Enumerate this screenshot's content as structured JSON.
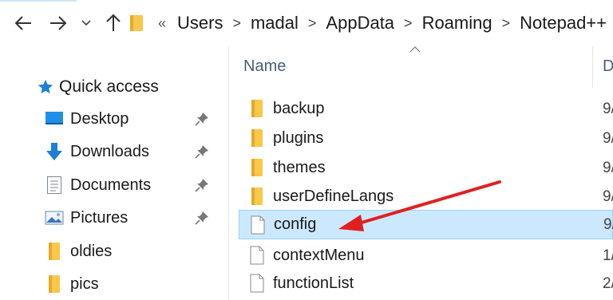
{
  "nav": {
    "back": "back",
    "forward": "forward",
    "recent": "recent-locations",
    "up": "up"
  },
  "breadcrumb": {
    "overflow": "«",
    "items": [
      "Users",
      "madal",
      "AppData",
      "Roaming",
      "Notepad++"
    ],
    "separator": ">"
  },
  "sidebar": {
    "quick_access": "Quick access",
    "items": [
      {
        "label": "Desktop",
        "icon": "desktop-icon",
        "pinned": true
      },
      {
        "label": "Downloads",
        "icon": "download-icon",
        "pinned": true
      },
      {
        "label": "Documents",
        "icon": "documents-icon",
        "pinned": true
      },
      {
        "label": "Pictures",
        "icon": "pictures-icon",
        "pinned": true
      },
      {
        "label": "oldies",
        "icon": "folder-icon",
        "pinned": false
      },
      {
        "label": "pics",
        "icon": "folder-icon",
        "pinned": false
      }
    ]
  },
  "list": {
    "column_name": "Name",
    "column_date_partial": "D",
    "rows": [
      {
        "name": "backup",
        "type": "folder",
        "date_partial": "9/"
      },
      {
        "name": "plugins",
        "type": "folder",
        "date_partial": "9/"
      },
      {
        "name": "themes",
        "type": "folder",
        "date_partial": "9/"
      },
      {
        "name": "userDefineLangs",
        "type": "folder",
        "date_partial": "9/"
      },
      {
        "name": "config",
        "type": "file",
        "date_partial": "9/",
        "selected": true
      },
      {
        "name": "contextMenu",
        "type": "file",
        "date_partial": "1/"
      },
      {
        "name": "functionList",
        "type": "file",
        "date_partial": "2/"
      }
    ]
  },
  "colors": {
    "accent": "#0078d7",
    "selection": "#cce8ff",
    "selection_border": "#99d1ff",
    "folder": "#f8c84a",
    "arrow": "#e02020"
  }
}
